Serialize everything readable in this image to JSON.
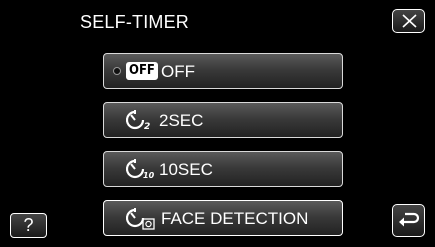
{
  "header": {
    "title": "SELF-TIMER"
  },
  "options": [
    {
      "label": "OFF",
      "badge": "OFF",
      "icon": "off-badge-icon",
      "selected": true
    },
    {
      "label": "2SEC",
      "icon": "timer-2sec-icon",
      "subscript": "2"
    },
    {
      "label": "10SEC",
      "icon": "timer-10sec-icon",
      "subscript": "10"
    },
    {
      "label": "FACE DETECTION",
      "icon": "face-detection-timer-icon"
    }
  ],
  "buttons": {
    "help": "?",
    "close_icon": "close-icon",
    "back_icon": "return-icon"
  }
}
